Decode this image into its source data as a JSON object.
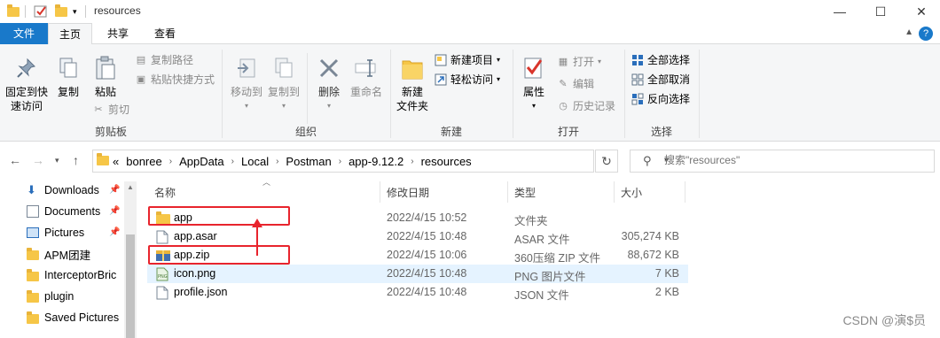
{
  "window": {
    "title": "resources"
  },
  "tabs": [
    {
      "label": "文件"
    },
    {
      "label": "主页"
    },
    {
      "label": "共享"
    },
    {
      "label": "查看"
    }
  ],
  "ribbon": {
    "clipboard": {
      "pin_label": "固定到快\n速访问",
      "copy_label": "复制",
      "paste_label": "粘贴",
      "copy_path_label": "复制路径",
      "paste_shortcut_label": "粘贴快捷方式",
      "cut_label": "剪切",
      "group_label": "剪贴板"
    },
    "organize": {
      "move_to_label": "移动到",
      "copy_to_label": "复制到",
      "delete_label": "删除",
      "rename_label": "重命名",
      "group_label": "组织"
    },
    "new": {
      "new_folder_label": "新建\n文件夹",
      "new_item_label": "新建项目",
      "easy_access_label": "轻松访问",
      "group_label": "新建"
    },
    "open": {
      "properties_label": "属性",
      "open_label": "打开",
      "edit_label": "编辑",
      "history_label": "历史记录",
      "group_label": "打开"
    },
    "select": {
      "select_all_label": "全部选择",
      "select_none_label": "全部取消",
      "invert_label": "反向选择",
      "group_label": "选择"
    }
  },
  "address": {
    "breadcrumbs": [
      "«",
      "bonree",
      "AppData",
      "Local",
      "Postman",
      "app-9.12.2",
      "resources"
    ]
  },
  "search": {
    "placeholder": "搜索\"resources\""
  },
  "nav_pane": [
    {
      "label": "Downloads",
      "icon": "download-arrow-icon",
      "pinned": true
    },
    {
      "label": "Documents",
      "icon": "document-icon",
      "pinned": true
    },
    {
      "label": "Pictures",
      "icon": "picture-icon",
      "pinned": true
    },
    {
      "label": "APM团建",
      "icon": "folder-icon",
      "pinned": false
    },
    {
      "label": "InterceptorBric",
      "icon": "folder-icon",
      "pinned": false
    },
    {
      "label": "plugin",
      "icon": "folder-icon",
      "pinned": false
    },
    {
      "label": "Saved Pictures",
      "icon": "folder-icon",
      "pinned": false
    }
  ],
  "columns": {
    "name": "名称",
    "date": "修改日期",
    "type": "类型",
    "size": "大小"
  },
  "files": [
    {
      "name": "app",
      "date": "2022/4/15 10:52",
      "type": "文件夹",
      "size": "",
      "icon": "folder-icon"
    },
    {
      "name": "app.asar",
      "date": "2022/4/15 10:48",
      "type": "ASAR 文件",
      "size": "305,274 KB",
      "icon": "file-icon"
    },
    {
      "name": "app.zip",
      "date": "2022/4/15 10:06",
      "type": "360压缩 ZIP 文件",
      "size": "88,672 KB",
      "icon": "zip-archive-icon"
    },
    {
      "name": "icon.png",
      "date": "2022/4/15 10:48",
      "type": "PNG 图片文件",
      "size": "7 KB",
      "icon": "png-image-icon"
    },
    {
      "name": "profile.json",
      "date": "2022/4/15 10:48",
      "type": "JSON 文件",
      "size": "2 KB",
      "icon": "file-icon"
    }
  ],
  "highlight_color": "#e8242d",
  "watermark": "CSDN @演$员"
}
